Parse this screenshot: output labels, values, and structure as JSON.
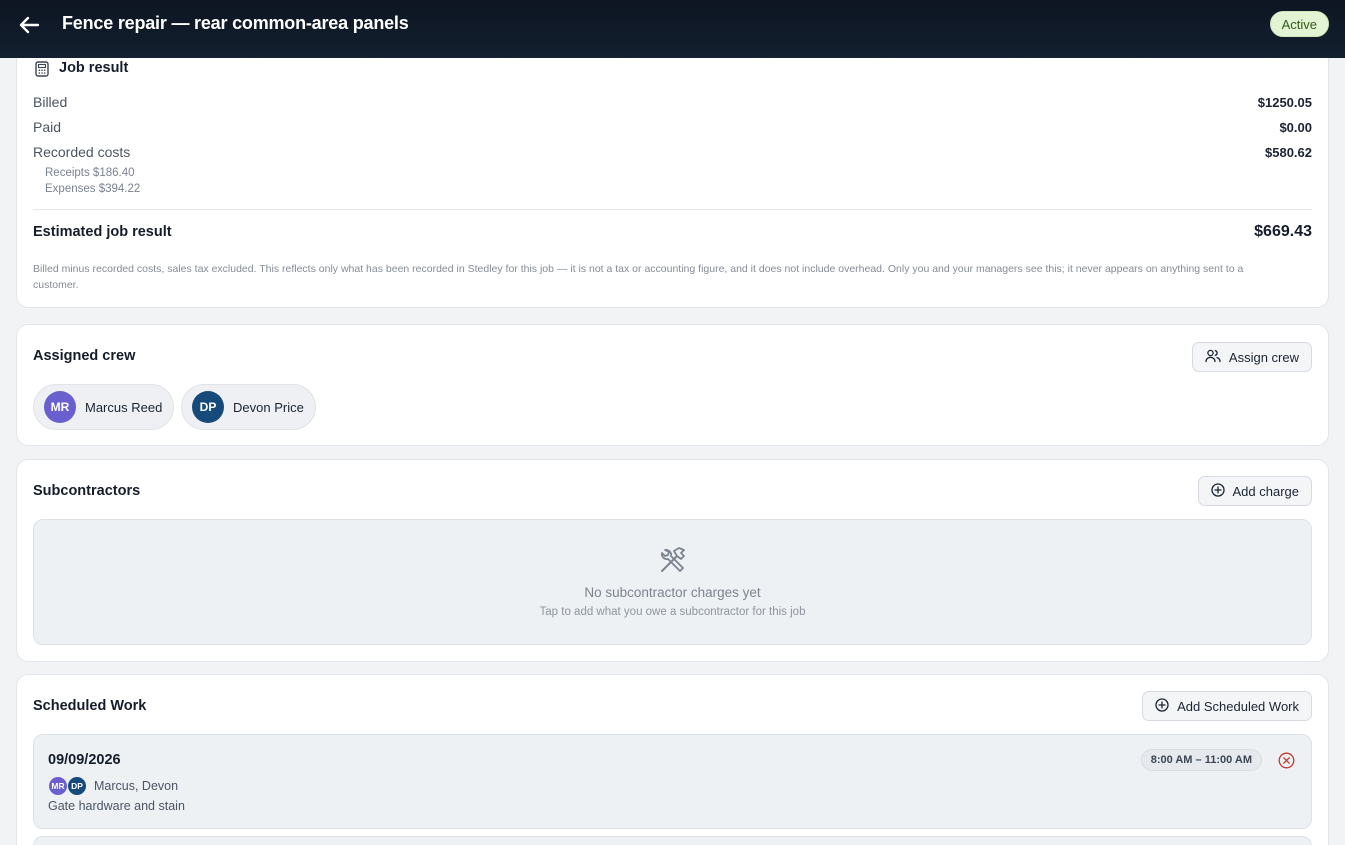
{
  "header": {
    "title": "Fence repair — rear common-area panels",
    "status": "Active"
  },
  "job_result": {
    "title": "Job result",
    "rows": [
      {
        "label": "Billed",
        "value": "$1250.05"
      },
      {
        "label": "Paid",
        "value": "$0.00"
      },
      {
        "label": "Recorded costs",
        "value": "$580.62"
      }
    ],
    "cost_breakdown": [
      "Receipts $186.40",
      "Expenses $394.22"
    ],
    "estimated_label": "Estimated job result",
    "estimated_value": "$669.43",
    "note": "Billed minus recorded costs, sales tax excluded. This reflects only what has been recorded in Stedley for this job — it is not a tax or accounting figure, and it does not include overhead. Only you and your managers see this; it never appears on anything sent to a customer."
  },
  "crew": {
    "title": "Assigned crew",
    "assign_label": "Assign crew",
    "members": [
      {
        "initials": "MR",
        "name": "Marcus Reed",
        "color": "#6a5fcf"
      },
      {
        "initials": "DP",
        "name": "Devon Price",
        "color": "#154a7a"
      }
    ]
  },
  "subcontractors": {
    "title": "Subcontractors",
    "add_label": "Add charge",
    "empty_title": "No subcontractor charges yet",
    "empty_subtitle": "Tap to add what you owe a subcontractor for this job"
  },
  "scheduled": {
    "title": "Scheduled Work",
    "add_label": "Add Scheduled Work",
    "items": [
      {
        "date": "09/09/2026",
        "time": "8:00 AM – 11:00 AM",
        "avatars": [
          "MR",
          "DP"
        ],
        "names": "Marcus, Devon",
        "description": "Gate hardware and stain"
      }
    ]
  },
  "colors": {
    "header_bg": "#0d1522",
    "active_badge": "#e3f4d4",
    "avatar_mr": "#6a5fcf",
    "avatar_dp": "#154a7a",
    "remove_icon": "#c0392b"
  }
}
